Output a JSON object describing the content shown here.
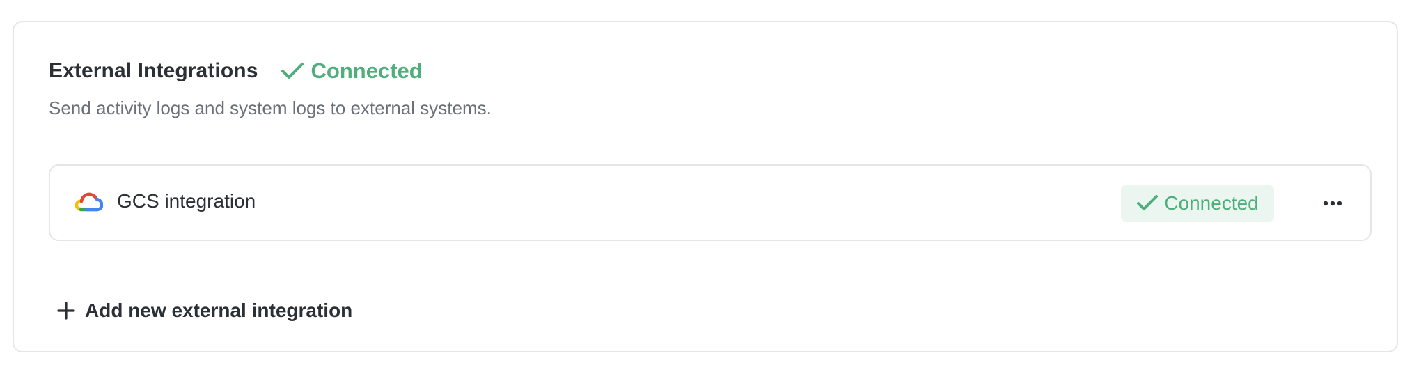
{
  "card": {
    "title": "External Integrations",
    "status_label": "Connected",
    "description": "Send activity logs and system logs to external systems."
  },
  "integrations": [
    {
      "name": "GCS integration",
      "icon": "google-cloud-icon",
      "status_label": "Connected",
      "more_icon": "more-horizontal-icon"
    }
  ],
  "actions": {
    "add_label": "Add new external integration",
    "add_icon": "plus-icon"
  },
  "colors": {
    "success": "#4fae7c",
    "success_bg": "#ebf6f0",
    "border": "#e6e6e9",
    "text_primary": "#2b2f36",
    "text_secondary": "#6b7078"
  }
}
